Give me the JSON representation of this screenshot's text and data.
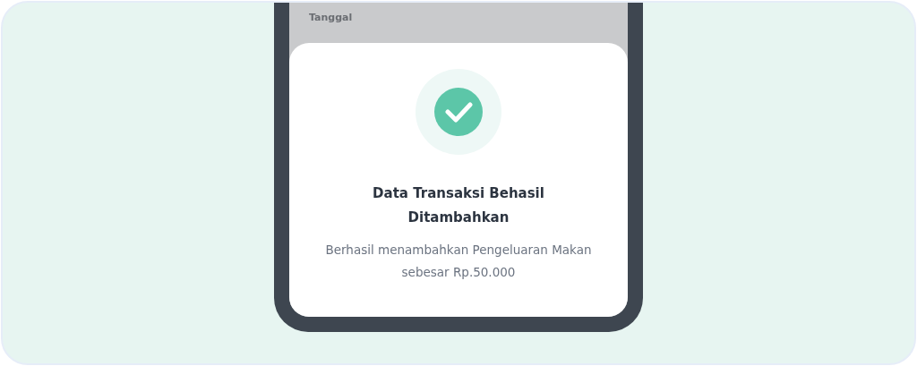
{
  "background_screen": {
    "label": "Tanggal"
  },
  "dialog": {
    "title": "Data Transaksi Behasil Ditambahkan",
    "message": "Berhasil menambahkan Pengeluaran Makan sebesar Rp.50.000"
  }
}
